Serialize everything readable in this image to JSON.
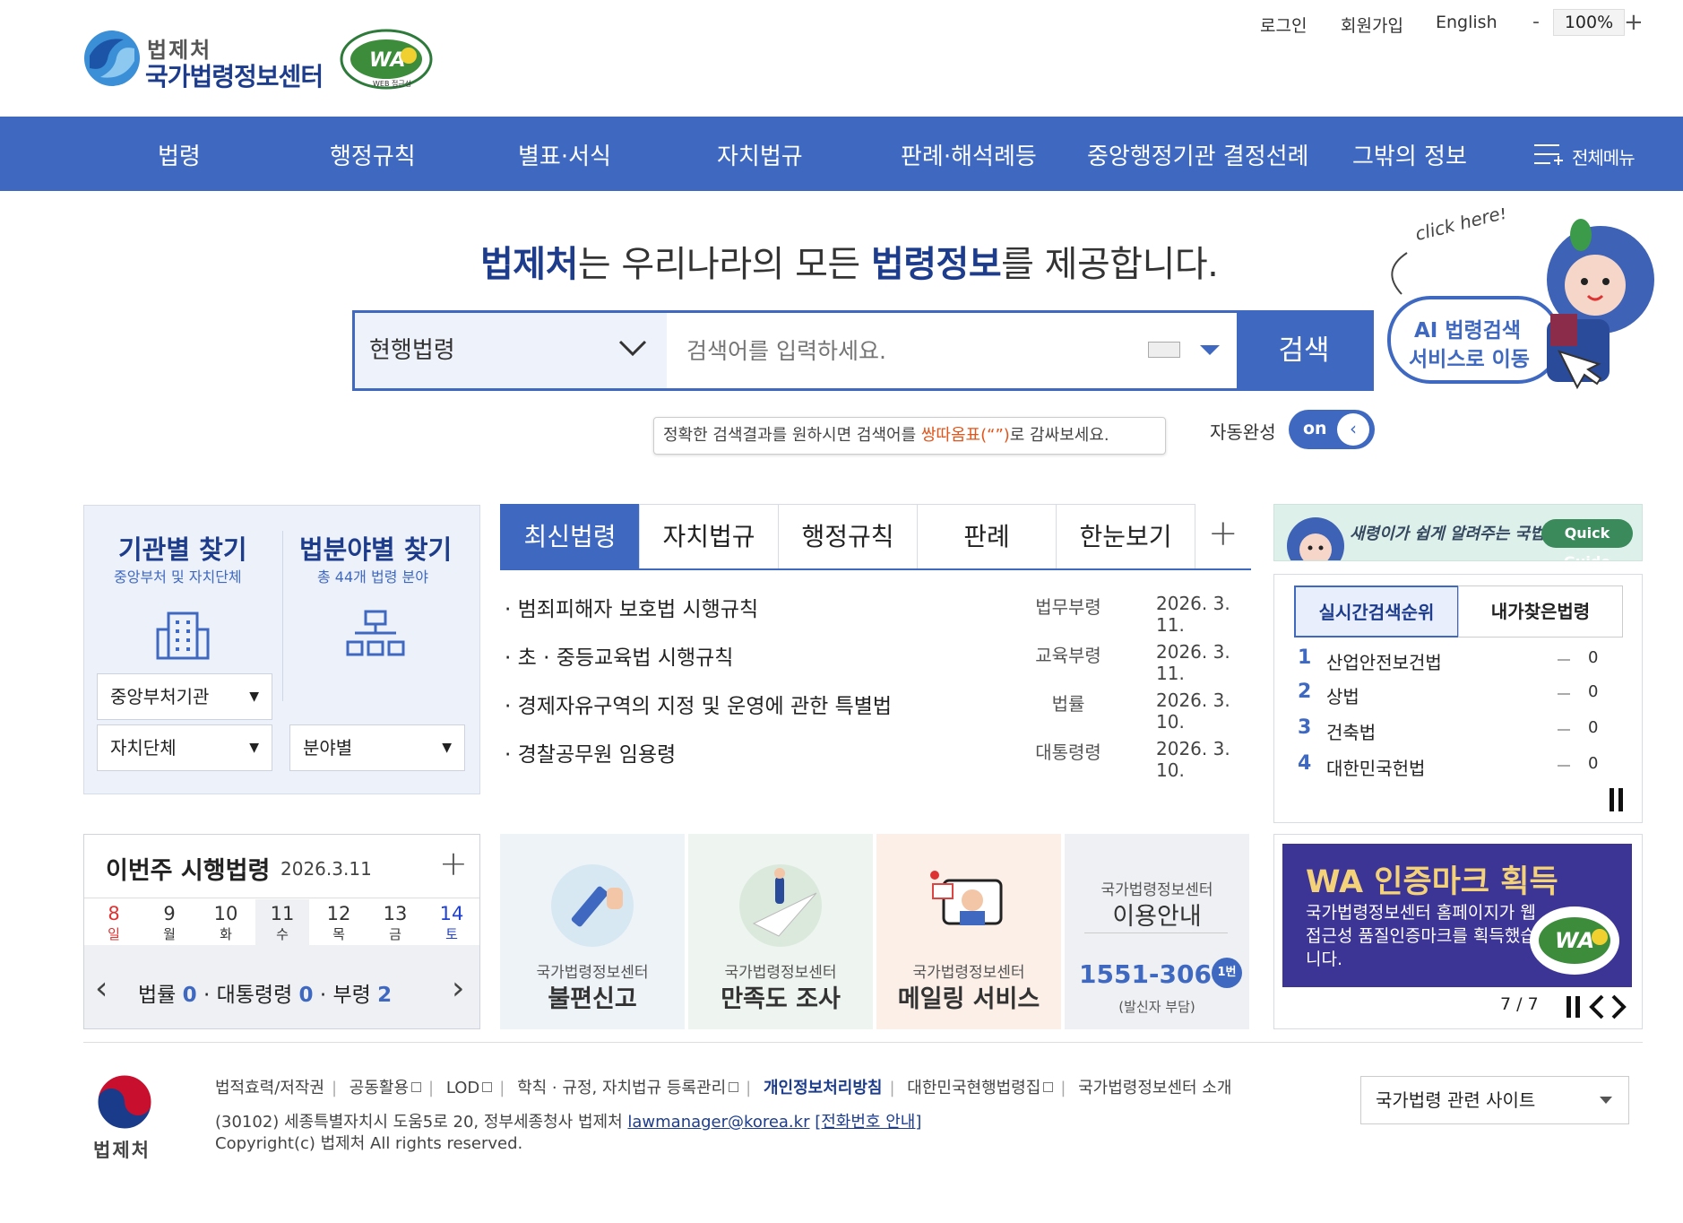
{
  "header": {
    "logo_line1": "법제처",
    "logo_line2": "국가법령정보센터",
    "wa_badge_label": "WA",
    "wa_badge_sub": "WEB 접근성",
    "util_links": [
      "로그인",
      "회원가입",
      "English"
    ],
    "zoom_minus": "-",
    "zoom_level": "100%",
    "zoom_plus": "+"
  },
  "nav": {
    "items": [
      "법령",
      "행정규칙",
      "별표·서식",
      "자치법규",
      "판례·해석례등",
      "중앙행정기관 결정선례",
      "그밖의 정보"
    ],
    "all_menu": "전체메뉴",
    "bg_color": "#3f69c1"
  },
  "hero": {
    "tagline_b1": "법제처",
    "tagline_t1": "는 우리나라의 모든 ",
    "tagline_b2": "법령정보",
    "tagline_t2": "를 제공합니다.",
    "scope_value": "현행법령",
    "search_placeholder": "검색어를 입력하세요.",
    "search_button": "검색",
    "tip_pre": "정확한 검색결과를 원하시면 검색어를 ",
    "tip_hl": "쌍따옴표(“”)",
    "tip_post": "로 감싸보세요.",
    "autocomplete_label": "자동완성",
    "autocomplete_state": "on",
    "ai_click": "click here!",
    "ai_line1": "AI 법령검색",
    "ai_line2": "서비스로 이동"
  },
  "finder": {
    "org_title": "기관별 찾기",
    "org_sub": "중앙부처 및 자치단체",
    "field_title": "법분야별 찾기",
    "field_sub": "총 44개 법령 분야",
    "select_central": "중앙부처기관",
    "select_local": "자치단체",
    "select_field": "분야별"
  },
  "tabs": {
    "items": [
      "최신법령",
      "자치법규",
      "행정규칙",
      "판례",
      "한눈보기"
    ],
    "active": "최신법령",
    "more": "+"
  },
  "laws": [
    {
      "title": "· 범죄피해자 보호법 시행규칙",
      "type": "법무부령",
      "date": "2026. 3. 11."
    },
    {
      "title": "· 초 · 중등교육법 시행규칙",
      "type": "교육부령",
      "date": "2026. 3. 11."
    },
    {
      "title": "· 경제자유구역의 지정 및 운영에 관한 특별법",
      "type": "법률",
      "date": "2026. 3. 10."
    },
    {
      "title": "· 경찰공무원 임용령",
      "type": "대통령령",
      "date": "2026. 3. 10."
    }
  ],
  "quick_guide": {
    "text": "새령이가 쉽게 알려주는 국법",
    "button": "Quick Guide"
  },
  "ranking": {
    "tab_realtime": "실시간검색순위",
    "tab_mine": "내가찾은법령",
    "items": [
      {
        "rank": "1",
        "name": "산업안전보건법",
        "change": "0"
      },
      {
        "rank": "2",
        "name": "상법",
        "change": "0"
      },
      {
        "rank": "3",
        "name": "건축법",
        "change": "0"
      },
      {
        "rank": "4",
        "name": "대한민국헌법",
        "change": "0"
      }
    ]
  },
  "weekly": {
    "title": "이번주 시행법령",
    "date": "2026.3.11",
    "more": "+",
    "days": [
      {
        "num": "8",
        "wd": "일"
      },
      {
        "num": "9",
        "wd": "월"
      },
      {
        "num": "10",
        "wd": "화"
      },
      {
        "num": "11",
        "wd": "수"
      },
      {
        "num": "12",
        "wd": "목"
      },
      {
        "num": "13",
        "wd": "금"
      },
      {
        "num": "14",
        "wd": "토"
      }
    ],
    "law_label": "법률",
    "law_count": "0",
    "decree_label": "대통령령",
    "decree_count": "0",
    "ministry_label": "부령",
    "ministry_count": "2"
  },
  "tiles": [
    {
      "sub": "국가법령정보센터",
      "main": "불편신고"
    },
    {
      "sub": "국가법령정보센터",
      "main": "만족도 조사"
    },
    {
      "sub": "국가법령정보센터",
      "main": "메일링 서비스"
    },
    {
      "sub": "국가법령정보센터",
      "main": "이용안내",
      "phone": "1551-3060",
      "ext": "1번",
      "note": "(발신자 부담)"
    }
  ],
  "wa_banner": {
    "title": "WA 인증마크 획득",
    "body": "국가법령정보센터 홈페이지가 웹 접근성 품질인증마크를 획득했습니다.",
    "pager": "7 / 7"
  },
  "footer": {
    "logo_text": "법제처",
    "links": [
      "법적효력/저작권",
      "공동활용",
      "LOD",
      "학칙 · 규정, 자치법규 등록관리",
      "개인정보처리방침",
      "대한민국현행법령집",
      "국가법령정보센터 소개"
    ],
    "address": "(30102) 세종특별자치시 도움5로 20, 정부세종청사 법제처",
    "email": "lawmanager@korea.kr",
    "phone_link": "[전화번호 안내]",
    "copyright": "Copyright(c) 법제처 All rights reserved.",
    "site_select": "국가법령 관련 사이트"
  }
}
